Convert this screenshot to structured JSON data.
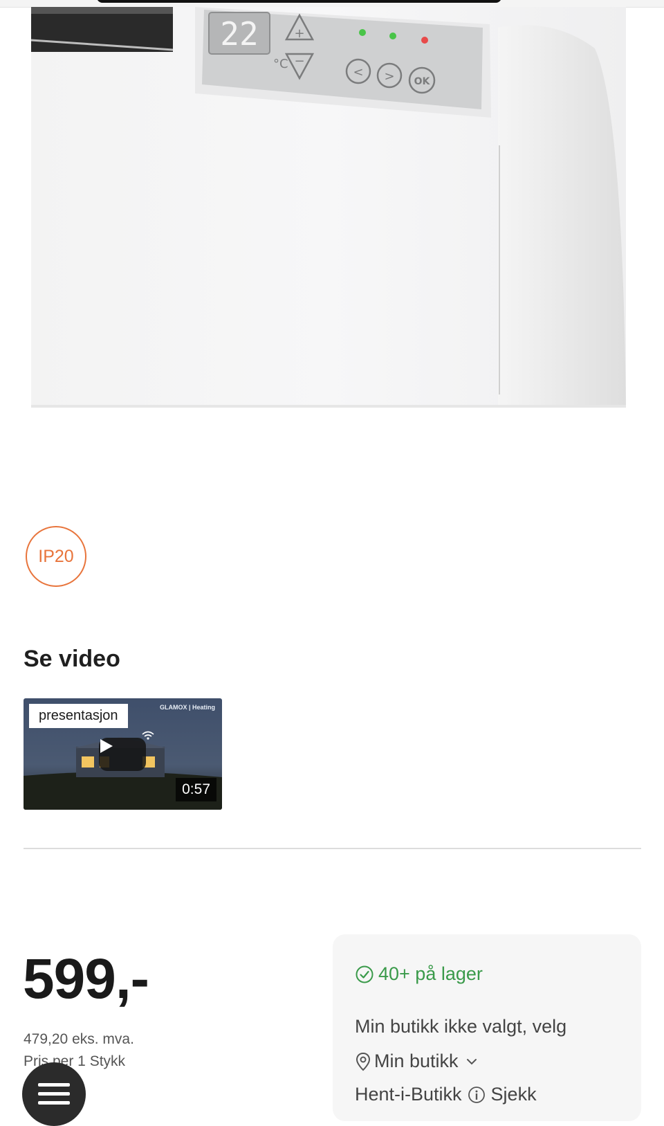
{
  "product": {
    "display_temperature": "22",
    "display_unit": "°C",
    "button_ok_label": "OK",
    "ip_rating": "IP20"
  },
  "video_section": {
    "heading": "Se video",
    "video": {
      "label": "presentasjon",
      "duration": "0:57",
      "brand": "GLAMOX | Heating"
    }
  },
  "pricing": {
    "price": "599,-",
    "price_ex_vat": "479,20 eks. mva.",
    "price_per": "Pris per 1 Stykk"
  },
  "stock": {
    "status": "40+ på lager",
    "store_text": "Min butikk ikke valgt, velg",
    "store_select": "Min butikk",
    "pickup_label": "Hent-i-Butikk",
    "pickup_check": "Sjekk"
  },
  "colors": {
    "accent_orange": "#e8743b",
    "stock_green": "#3a9a4a",
    "card_bg": "#f6f6f6"
  }
}
